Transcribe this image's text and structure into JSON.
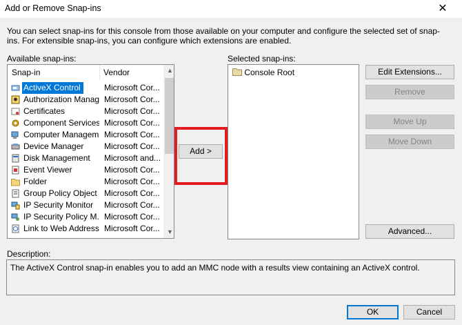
{
  "window": {
    "title": "Add or Remove Snap-ins",
    "close_glyph": "✕"
  },
  "intro_text": "You can select snap-ins for this console from those available on your computer and configure the selected set of snap-ins. For extensible snap-ins, you can configure which extensions are enabled.",
  "available": {
    "label": "Available snap-ins:",
    "columns": {
      "snapin": "Snap-in",
      "vendor": "Vendor"
    },
    "rows": [
      {
        "name": "ActiveX Control",
        "vendor": "Microsoft Cor...",
        "icon": "activex-icon",
        "selected": true
      },
      {
        "name": "Authorization Manager",
        "vendor": "Microsoft Cor...",
        "icon": "authorization-icon"
      },
      {
        "name": "Certificates",
        "vendor": "Microsoft Cor...",
        "icon": "certificate-icon"
      },
      {
        "name": "Component Services",
        "vendor": "Microsoft Cor...",
        "icon": "gear-icon"
      },
      {
        "name": "Computer Managem...",
        "vendor": "Microsoft Cor...",
        "icon": "computer-management-icon"
      },
      {
        "name": "Device Manager",
        "vendor": "Microsoft Cor...",
        "icon": "device-manager-icon"
      },
      {
        "name": "Disk Management",
        "vendor": "Microsoft and...",
        "icon": "disk-icon"
      },
      {
        "name": "Event Viewer",
        "vendor": "Microsoft Cor...",
        "icon": "event-viewer-icon"
      },
      {
        "name": "Folder",
        "vendor": "Microsoft Cor...",
        "icon": "folder-icon"
      },
      {
        "name": "Group Policy Object ...",
        "vendor": "Microsoft Cor...",
        "icon": "group-policy-icon"
      },
      {
        "name": "IP Security Monitor",
        "vendor": "Microsoft Cor...",
        "icon": "ip-security-icon"
      },
      {
        "name": "IP Security Policy M...",
        "vendor": "Microsoft Cor...",
        "icon": "ip-security-policy-icon"
      },
      {
        "name": "Link to Web Address",
        "vendor": "Microsoft Cor...",
        "icon": "web-link-icon"
      }
    ]
  },
  "add_button": "Add >",
  "selected": {
    "label": "Selected snap-ins:",
    "root_item": "Console Root"
  },
  "buttons": {
    "edit_extensions": "Edit Extensions...",
    "remove": "Remove",
    "move_up": "Move Up",
    "move_down": "Move Down",
    "advanced": "Advanced...",
    "ok": "OK",
    "cancel": "Cancel"
  },
  "description": {
    "label": "Description:",
    "text": "The ActiveX Control snap-in enables you to add an MMC node with a results view containing an ActiveX control."
  },
  "colors": {
    "selection": "#0078d7",
    "highlight_border": "#e31b23"
  }
}
